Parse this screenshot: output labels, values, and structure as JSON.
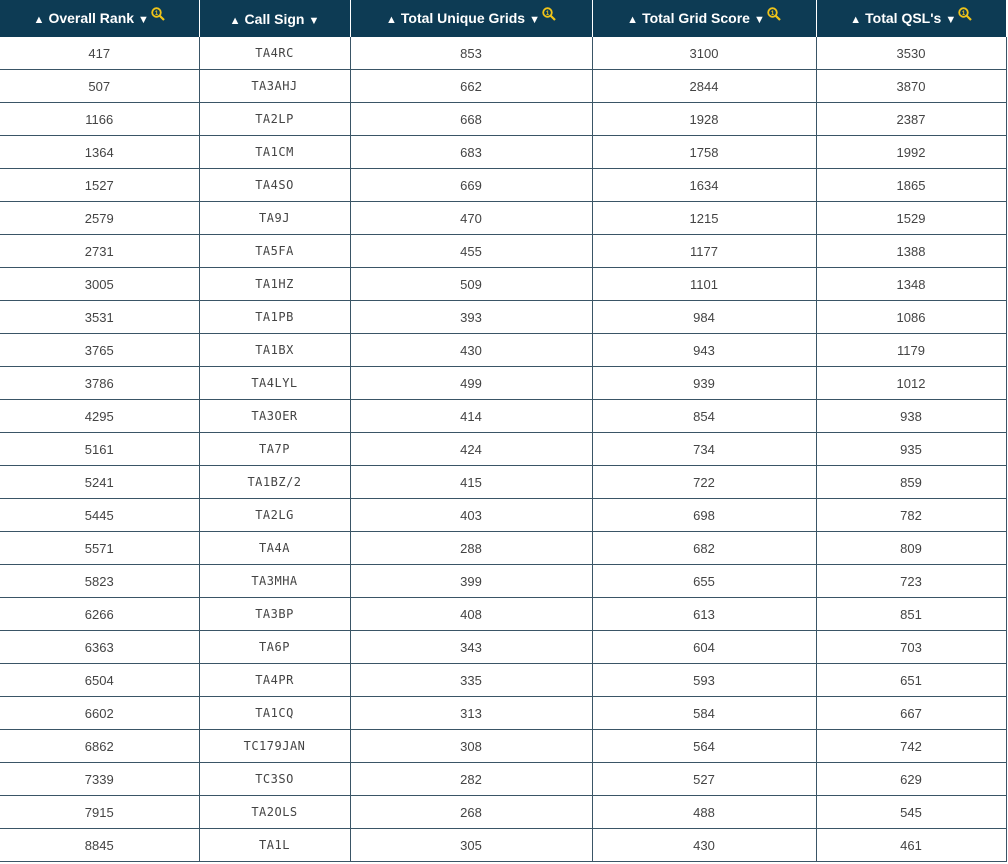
{
  "icons": {
    "sort_up": "▲",
    "sort_down": "▼",
    "search": "search-icon",
    "accent": "#f0c419"
  },
  "columns": [
    {
      "label": "Overall Rank",
      "has_search": true
    },
    {
      "label": "Call Sign",
      "has_search": false
    },
    {
      "label": "Total Unique Grids",
      "has_search": true
    },
    {
      "label": "Total Grid Score",
      "has_search": true
    },
    {
      "label": "Total QSL's",
      "has_search": true
    }
  ],
  "rows": [
    [
      "417",
      "TA4RC",
      "853",
      "3100",
      "3530"
    ],
    [
      "507",
      "TA3AHJ",
      "662",
      "2844",
      "3870"
    ],
    [
      "1166",
      "TA2LP",
      "668",
      "1928",
      "2387"
    ],
    [
      "1364",
      "TA1CM",
      "683",
      "1758",
      "1992"
    ],
    [
      "1527",
      "TA4SO",
      "669",
      "1634",
      "1865"
    ],
    [
      "2579",
      "TA9J",
      "470",
      "1215",
      "1529"
    ],
    [
      "2731",
      "TA5FA",
      "455",
      "1177",
      "1388"
    ],
    [
      "3005",
      "TA1HZ",
      "509",
      "1101",
      "1348"
    ],
    [
      "3531",
      "TA1PB",
      "393",
      "984",
      "1086"
    ],
    [
      "3765",
      "TA1BX",
      "430",
      "943",
      "1179"
    ],
    [
      "3786",
      "TA4LYL",
      "499",
      "939",
      "1012"
    ],
    [
      "4295",
      "TA3OER",
      "414",
      "854",
      "938"
    ],
    [
      "5161",
      "TA7P",
      "424",
      "734",
      "935"
    ],
    [
      "5241",
      "TA1BZ/2",
      "415",
      "722",
      "859"
    ],
    [
      "5445",
      "TA2LG",
      "403",
      "698",
      "782"
    ],
    [
      "5571",
      "TA4A",
      "288",
      "682",
      "809"
    ],
    [
      "5823",
      "TA3MHA",
      "399",
      "655",
      "723"
    ],
    [
      "6266",
      "TA3BP",
      "408",
      "613",
      "851"
    ],
    [
      "6363",
      "TA6P",
      "343",
      "604",
      "703"
    ],
    [
      "6504",
      "TA4PR",
      "335",
      "593",
      "651"
    ],
    [
      "6602",
      "TA1CQ",
      "313",
      "584",
      "667"
    ],
    [
      "6862",
      "TC179JAN",
      "308",
      "564",
      "742"
    ],
    [
      "7339",
      "TC3SO",
      "282",
      "527",
      "629"
    ],
    [
      "7915",
      "TA2OLS",
      "268",
      "488",
      "545"
    ],
    [
      "8845",
      "TA1L",
      "305",
      "430",
      "461"
    ]
  ]
}
